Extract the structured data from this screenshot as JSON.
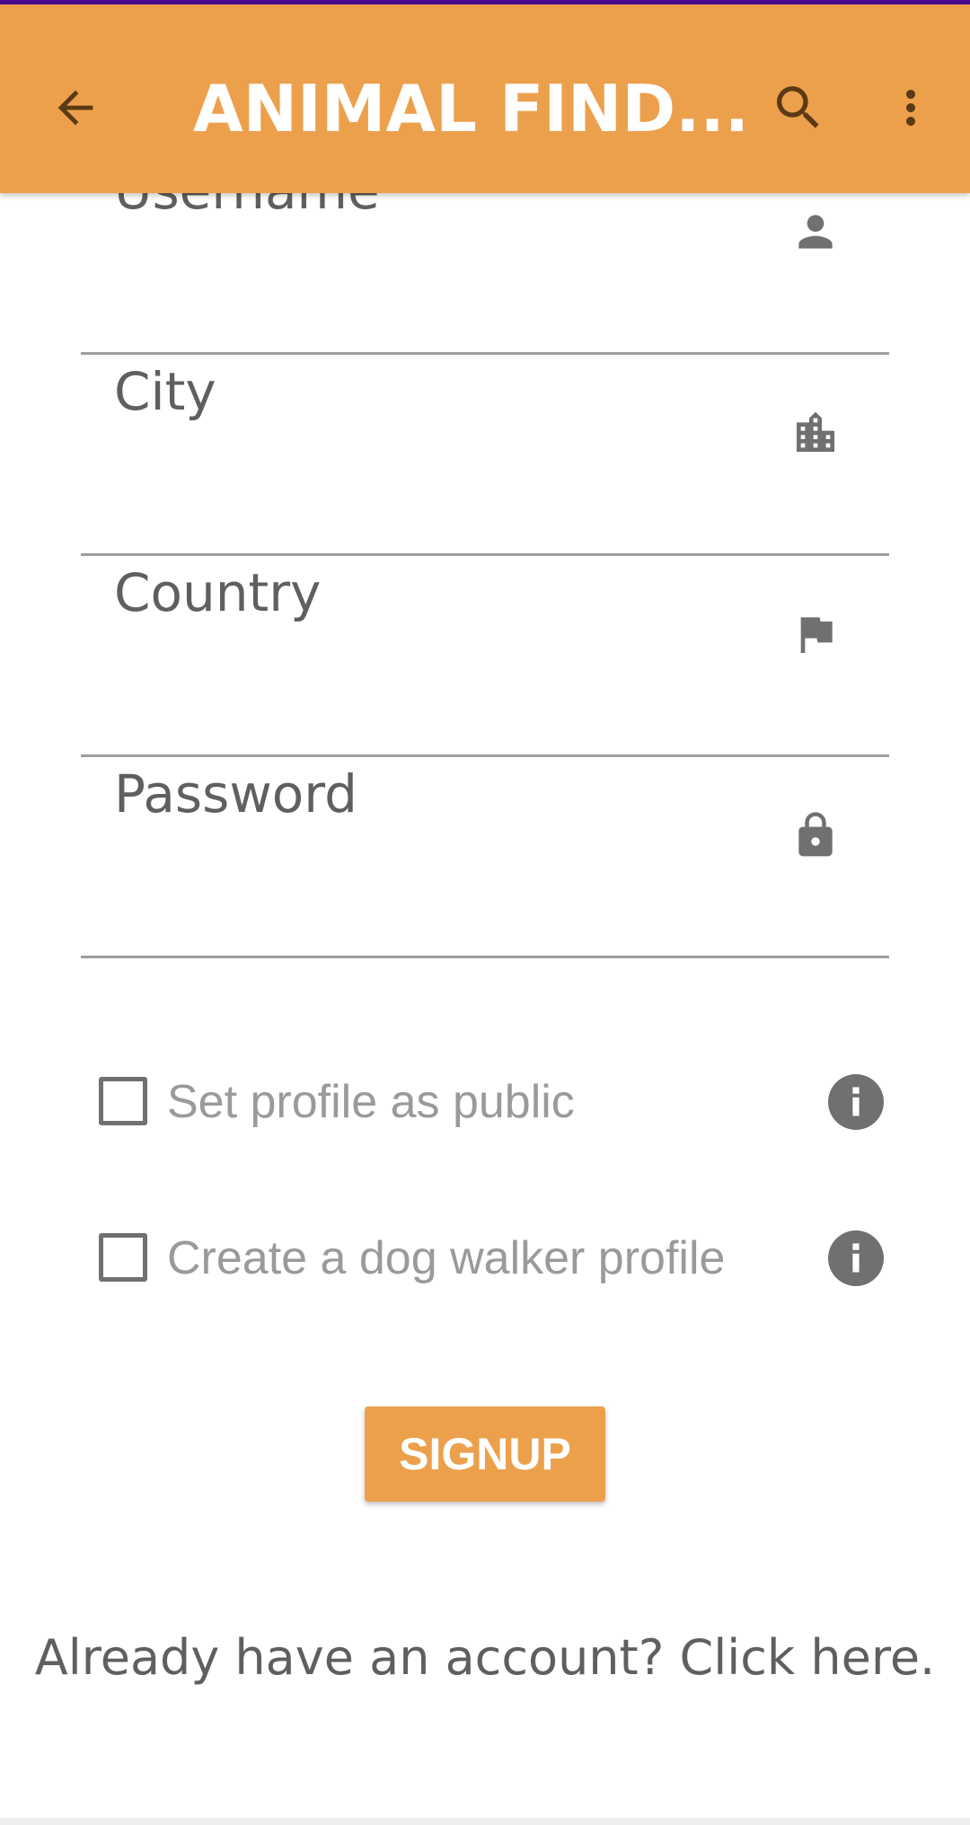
{
  "app_bar": {
    "title": "ANIMAL FIND...",
    "back_icon": "arrow-back-icon",
    "search_icon": "search-icon",
    "more_icon": "more-vert-icon",
    "color": "#eda04c"
  },
  "form": {
    "fields": [
      {
        "label": "Username",
        "value": "",
        "icon": "person-icon"
      },
      {
        "label": "City",
        "value": "",
        "icon": "city-icon"
      },
      {
        "label": "Country",
        "value": "",
        "icon": "flag-icon"
      },
      {
        "label": "Password",
        "value": "",
        "icon": "lock-icon"
      }
    ],
    "checkboxes": [
      {
        "label": "Set profile as public",
        "checked": false,
        "icon": "info-icon"
      },
      {
        "label": "Create a dog walker profile",
        "checked": false,
        "icon": "info-icon"
      }
    ],
    "signup_label": "SIGNUP"
  },
  "footer": {
    "login_link": "Already have an account? Click here."
  },
  "colors": {
    "accent": "#eda04c",
    "status_bar": "#4a0c8c",
    "label_text": "#5f5f5f",
    "icon": "#707070"
  }
}
